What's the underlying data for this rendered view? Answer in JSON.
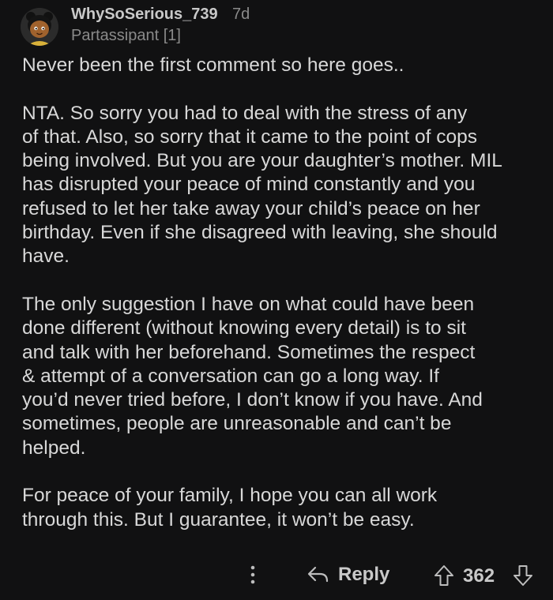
{
  "comment": {
    "username": "WhySoSerious_739",
    "age": "7d",
    "flair": "Partassipant [1]",
    "paragraphs": [
      "Never been the first comment so here goes..",
      "NTA. So sorry you had to deal with the stress of any\nof that. Also, so sorry that it came to the point of cops\nbeing involved. But you are your daughter’s mother. MIL\nhas disrupted your peace of mind constantly and you\nrefused to let her take away your child’s peace on her\nbirthday. Even if she disagreed with leaving, she should\nhave.",
      "The only suggestion I have on what could have been\ndone different (without knowing every detail) is to sit\nand talk with her beforehand. Sometimes the respect\n& attempt of a conversation can go a long way. If\nyou’d never tried before, I don’t know if you have. And\nsometimes, people are unreasonable and can’t be\nhelped.",
      "For peace of your family, I hope you can all work\nthrough this. But I guarantee, it won’t be easy."
    ]
  },
  "actions": {
    "more_icon": "vertical-dots-icon",
    "reply_icon": "reply-arrow-icon",
    "reply_label": "Reply",
    "upvote_icon": "upvote-arrow-icon",
    "score": "362",
    "downvote_icon": "downvote-arrow-icon"
  },
  "colors": {
    "background": "#111112",
    "text": "#d8d8d8",
    "muted": "#8a8a8a",
    "avatar_skin": "#a0622d"
  }
}
